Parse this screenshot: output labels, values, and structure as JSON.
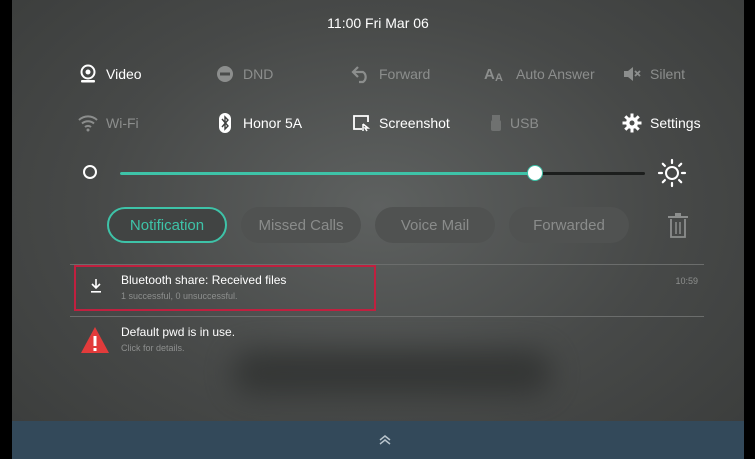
{
  "status": {
    "time": "11:00 Fri Mar 06"
  },
  "quick_settings": {
    "row1": [
      {
        "label": "Video",
        "icon": "video-icon",
        "state": "on"
      },
      {
        "label": "DND",
        "icon": "dnd-icon",
        "state": "off"
      },
      {
        "label": "Forward",
        "icon": "forward-icon",
        "state": "off"
      },
      {
        "label": "Auto Answer",
        "icon": "auto-answer-icon",
        "state": "off"
      },
      {
        "label": "Silent",
        "icon": "silent-icon",
        "state": "off"
      }
    ],
    "row2": [
      {
        "label": "Wi-Fi",
        "icon": "wifi-icon",
        "state": "off"
      },
      {
        "label": "Honor 5A",
        "icon": "bluetooth-icon",
        "state": "on"
      },
      {
        "label": "Screenshot",
        "icon": "screenshot-icon",
        "state": "on"
      },
      {
        "label": "USB",
        "icon": "usb-icon",
        "state": "off"
      },
      {
        "label": "Settings",
        "icon": "gear-icon",
        "state": "on"
      }
    ]
  },
  "brightness": {
    "level": 0.79
  },
  "tabs": [
    {
      "label": "Notification",
      "active": true
    },
    {
      "label": "Missed Calls",
      "active": false
    },
    {
      "label": "Voice Mail",
      "active": false
    },
    {
      "label": "Forwarded",
      "active": false
    }
  ],
  "notifications": [
    {
      "title": "Bluetooth share: Received files",
      "subtitle": "1 successful, 0 unsuccessful.",
      "time": "10:59",
      "icon": "download-icon"
    },
    {
      "title": "Default pwd is in use.",
      "subtitle": "Click for details.",
      "time": "",
      "icon": "warning-icon"
    }
  ],
  "colors": {
    "accent": "#3ec3a8",
    "highlight": "#c0203f",
    "bottom_bar": "#33495a",
    "warning": "#e23b3b"
  }
}
